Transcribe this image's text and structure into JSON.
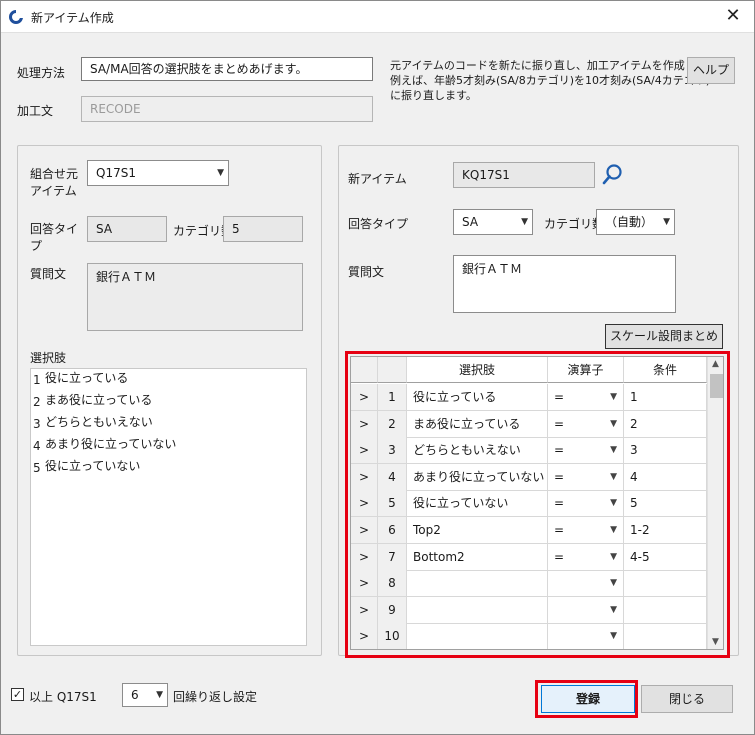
{
  "window": {
    "title": "新アイテム作成",
    "close_glyph": "✕"
  },
  "top": {
    "method_label": "処理方法",
    "method_value": "SA/MA回答の選択肢をまとめあげます。",
    "processed_label": "加工文",
    "processed_value": "RECODE",
    "description_lines": [
      "元アイテムのコードを新たに振り直し、加工アイテムを作成します。",
      "例えば、年齢5才刻み(SA/8カテゴリ)を10才刻み(SA/4カテゴリ)",
      "に振り直します。"
    ],
    "help_button": "ヘルプ"
  },
  "left": {
    "combine_label_line1": "組合せ元",
    "combine_label_line2": "アイテム",
    "combine_value": "Q17S1",
    "answer_type_label_line1": "回答タイ",
    "answer_type_label_line2": "プ",
    "answer_type_value": "SA",
    "category_count_label": "カテゴリ数",
    "category_count_value": "5",
    "question_label": "質問文",
    "question_text": "銀行ＡＴＭ",
    "choices_label": "選択肢",
    "choices": [
      {
        "num": "1",
        "text": "役に立っている"
      },
      {
        "num": "2",
        "text": "まあ役に立っている"
      },
      {
        "num": "3",
        "text": "どちらともいえない"
      },
      {
        "num": "4",
        "text": "あまり役に立っていない"
      },
      {
        "num": "5",
        "text": "役に立っていない"
      }
    ]
  },
  "right": {
    "new_item_label": "新アイテム",
    "new_item_value": "KQ17S1",
    "search_icon": "search-icon",
    "answer_type_label": "回答タイプ",
    "answer_type_value": "SA",
    "category_count_label": "カテゴリ数",
    "category_count_value": "（自動）",
    "question_label": "質問文",
    "question_text": "銀行ＡＴＭ",
    "scale_button": "スケール設問まとめ"
  },
  "grid": {
    "headers": {
      "choice": "選択肢",
      "operator": "演算子",
      "condition": "条件"
    },
    "rows": [
      {
        "sel": ">",
        "no": "1",
        "choice": "役に立っている",
        "op": "=",
        "cond": "1"
      },
      {
        "sel": ">",
        "no": "2",
        "choice": "まあ役に立っている",
        "op": "=",
        "cond": "2"
      },
      {
        "sel": ">",
        "no": "3",
        "choice": "どちらともいえない",
        "op": "=",
        "cond": "3"
      },
      {
        "sel": ">",
        "no": "4",
        "choice": "あまり役に立っていない",
        "op": "=",
        "cond": "4"
      },
      {
        "sel": ">",
        "no": "5",
        "choice": "役に立っていない",
        "op": "=",
        "cond": "5"
      },
      {
        "sel": ">",
        "no": "6",
        "choice": "Top2",
        "op": "=",
        "cond": "1-2"
      },
      {
        "sel": ">",
        "no": "7",
        "choice": "Bottom2",
        "op": "=",
        "cond": "4-5"
      },
      {
        "sel": ">",
        "no": "8",
        "choice": "",
        "op": "",
        "cond": ""
      },
      {
        "sel": ">",
        "no": "9",
        "choice": "",
        "op": "",
        "cond": ""
      },
      {
        "sel": ">",
        "no": "10",
        "choice": "",
        "op": "",
        "cond": ""
      }
    ]
  },
  "bottom": {
    "above_label": "以上 Q17S1",
    "repeat_value": "6",
    "repeat_label": "回繰り返し設定",
    "register_button": "登録",
    "close_button": "閉じる"
  },
  "colors": {
    "highlight": "#e60012"
  }
}
